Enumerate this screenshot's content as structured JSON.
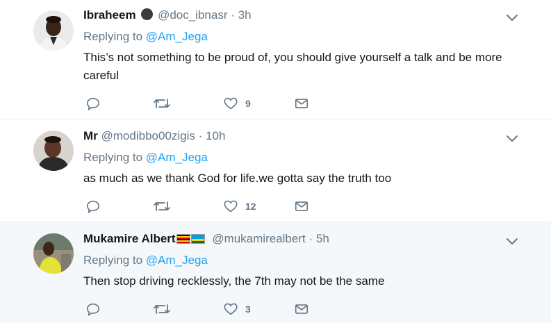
{
  "tweets": [
    {
      "name": "Ibraheem",
      "badge_icon": "dark-circle-icon",
      "handle": "@doc_ibnasr",
      "time": "3h",
      "replying_prefix": "Replying to",
      "replying_to": "@Am_Jega",
      "text": "This’s not something to be proud of, you should give yourself a talk and be more careful",
      "replies": "",
      "retweets": "",
      "likes": "9"
    },
    {
      "name": "Mr",
      "handle": "@modibbo00zigis",
      "time": "10h",
      "replying_prefix": "Replying to",
      "replying_to": "@Am_Jega",
      "text": "as much as we thank God for life.we gotta say the truth too",
      "replies": "",
      "retweets": "",
      "likes": "12"
    },
    {
      "name": "Mukamire Albert",
      "flags": [
        "uganda-flag-icon",
        "rwanda-flag-icon"
      ],
      "handle": "@mukamirealbert",
      "time": "5h",
      "replying_prefix": "Replying to",
      "replying_to": "@Am_Jega",
      "text": "Then stop driving recklessly, the 7th may not be the same",
      "replies": "",
      "retweets": "",
      "likes": "3"
    }
  ],
  "colors": {
    "link": "#1da1f2",
    "muted": "#657786",
    "text": "#14171a",
    "hover_bg": "#f5f8fa",
    "divider": "#e6ecf0"
  },
  "separator": "·"
}
